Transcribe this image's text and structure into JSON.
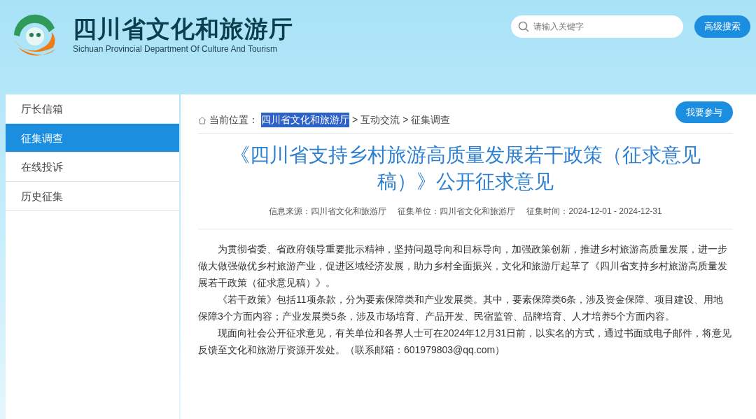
{
  "header": {
    "title": "四川省文化和旅游厅",
    "subtitle": "Sichuan Provincial Department Of Culture And Tourism",
    "search": {
      "placeholder": "请输入关键字"
    },
    "advanced_search": "高级搜索"
  },
  "sidebar": {
    "items": [
      {
        "label": "厅长信箱",
        "selected": false
      },
      {
        "label": "征集调查",
        "selected": true
      },
      {
        "label": "在线投诉",
        "selected": false
      },
      {
        "label": "历史征集",
        "selected": false
      }
    ]
  },
  "breadcrumb": {
    "prefix": "当前位置：",
    "items": [
      {
        "label": "四川省文化和旅游厅",
        "highlighted": true
      },
      {
        "label": "互动交流",
        "highlighted": false
      },
      {
        "label": "征集调查",
        "highlighted": false
      }
    ],
    "separator": ">"
  },
  "participate_button": "我要参与",
  "article": {
    "title": "《四川省支持乡村旅游高质量发展若干政策（征求意见稿）》公开征求意见",
    "meta": [
      "信息来源：四川省文化和旅游厅",
      "征集单位：四川省文化和旅游厅",
      "征集时间：2024-12-01 - 2024-12-31"
    ],
    "paragraphs": [
      "为贯彻省委、省政府领导重要批示精神，坚持问题导向和目标导向，加强政策创新，推进乡村旅游高质量发展，进一步做大做强做优乡村旅游产业，促进区域经济发展，助力乡村全面振兴，文化和旅游厅起草了《四川省支持乡村旅游高质量发展若干政策（征求意见稿）》。",
      "《若干政策》包括11项条款，分为要素保障类和产业发展类。其中，要素保障类6条，涉及资金保障、项目建设、用地保障3个方面内容；产业发展类5条，涉及市场培育、产品开发、民宿监管、品牌培育、人才培养5个方面内容。",
      "现面向社会公开征求意见，有关单位和各界人士可在2024年12月31日前，以实名的方式，通过书面或电子邮件，将意见反馈至文化和旅游厅资源开发处。（联系邮箱：601979803@qq.com）"
    ]
  }
}
